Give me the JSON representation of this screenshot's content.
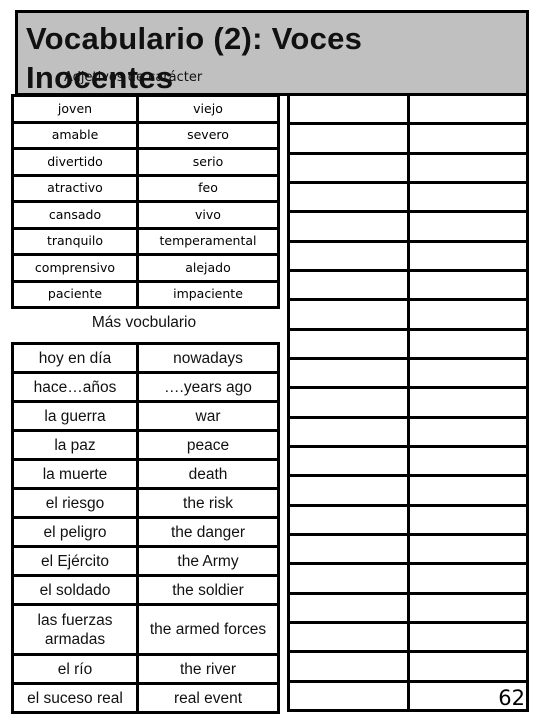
{
  "title": {
    "heading": "Vocabulario (2): Voces Inocentes",
    "subtitle": "Adjetivos de carácter",
    "background_color": "#c0c0c0"
  },
  "adjectives_table": {
    "rows": [
      {
        "es": "joven",
        "opposite": "viejo"
      },
      {
        "es": "amable",
        "opposite": "severo"
      },
      {
        "es": "divertido",
        "opposite": "serio"
      },
      {
        "es": "atractivo",
        "opposite": "feo"
      },
      {
        "es": "cansado",
        "opposite": "vivo"
      },
      {
        "es": "tranquilo",
        "opposite": "temperamental"
      },
      {
        "es": "comprensivo",
        "opposite": "alejado"
      },
      {
        "es": "paciente",
        "opposite": "impaciente"
      }
    ]
  },
  "more_vocab": {
    "heading": "Más vocbulario",
    "rows": [
      {
        "es": "hoy en día",
        "en": "nowadays"
      },
      {
        "es": "hace…años",
        "en": "….years ago"
      },
      {
        "es": "la guerra",
        "en": "war"
      },
      {
        "es": "la paz",
        "en": "peace"
      },
      {
        "es": "la muerte",
        "en": "death"
      },
      {
        "es": "el riesgo",
        "en": "the risk"
      },
      {
        "es": "el peligro",
        "en": "the danger"
      },
      {
        "es": "el Ejército",
        "en": "the Army"
      },
      {
        "es": "el soldado",
        "en": "the soldier"
      },
      {
        "es": "las fuerzas armadas",
        "en": "the armed forces"
      },
      {
        "es": "el río",
        "en": "the river"
      },
      {
        "es": "el suceso real",
        "en": "real event"
      }
    ]
  },
  "blank_grid": {
    "rows": 21,
    "columns": 2
  },
  "page_number": "62"
}
